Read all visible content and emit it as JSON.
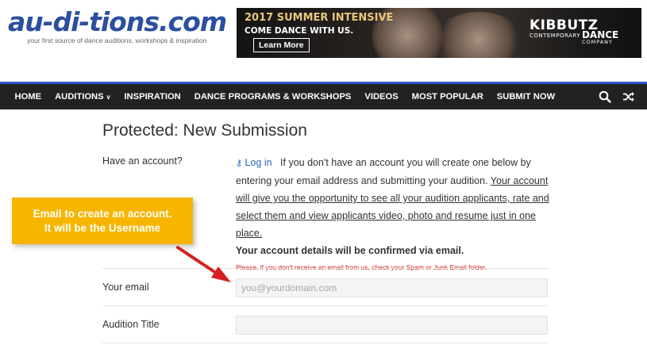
{
  "header": {
    "logo_text": "au-di-tions.com",
    "tagline": "your first source of dance auditions, workshops & inspiration"
  },
  "banner": {
    "headline": "2017 SUMMER INTENSIVE",
    "subline": "COME DANCE WITH US.",
    "button_label": "Learn More",
    "brand_line1": "KIBBUTZ",
    "brand_line2": "CONTEMPORARY",
    "brand_line3": "DANCE",
    "brand_line4": "COMPANY"
  },
  "nav": {
    "items": [
      {
        "label": "HOME"
      },
      {
        "label": "AUDITIONS",
        "has_dropdown": true
      },
      {
        "label": "INSPIRATION"
      },
      {
        "label": "DANCE PROGRAMS & WORKSHOPS"
      },
      {
        "label": "VIDEOS"
      },
      {
        "label": "MOST POPULAR"
      },
      {
        "label": "SUBMIT NOW"
      }
    ],
    "icons": [
      "search-icon",
      "shuffle-icon"
    ]
  },
  "page": {
    "title": "Protected: New Submission",
    "account_label": "Have an account?",
    "login_link": "Log in",
    "intro_text": "If you don't have an account you will create one below by entering your email address and submitting your audition.",
    "underlined_text": "Your account will give you the opportunity to see all your audition applicants, rate and select them and view applicants video, photo and resume just in one place.",
    "bold_text": "Your account details will be confirmed via email.",
    "warning_text": "Please, if you don't receive an email from us, check your Spam or Junk Email folder."
  },
  "form": {
    "email_label": "Your email",
    "email_placeholder": "you@yourdomain.com",
    "email_value": "",
    "title_label": "Audition Title",
    "title_placeholder": "",
    "title_value": ""
  },
  "callout": {
    "line1": "Email to create an account.",
    "line2": "It will be the Username"
  },
  "colors": {
    "logo_blue": "#2b4f9e",
    "nav_bg": "#222222",
    "nav_accent": "#2d58c9",
    "link_blue": "#2b63b8",
    "warning_red": "#d11a1a",
    "callout_yellow": "#f7b500",
    "arrow_red": "#d62020"
  }
}
